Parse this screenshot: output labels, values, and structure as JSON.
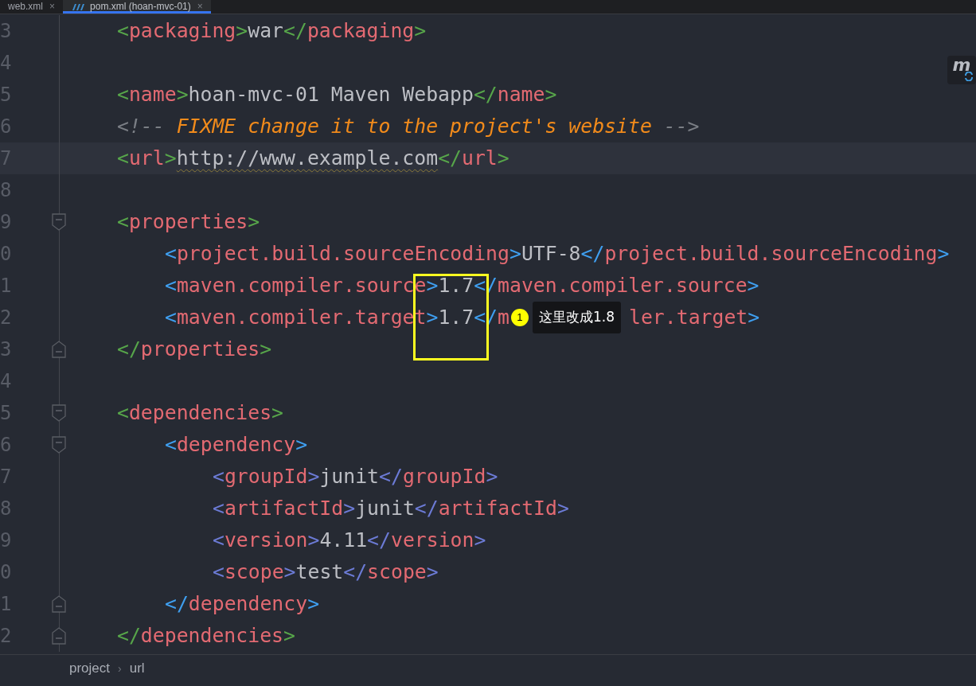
{
  "tabs": [
    {
      "label": "web.xml",
      "close": "×",
      "selected": false
    },
    {
      "label": "pom.xml (hoan-mvc-01)",
      "close": "×",
      "selected": true
    }
  ],
  "maven_button": {
    "glyph": "m"
  },
  "lines": [
    {
      "number": "3",
      "tokens": [
        {
          "kind": "bracket",
          "text": "<"
        },
        {
          "kind": "tag",
          "text": "packaging"
        },
        {
          "kind": "bracket",
          "text": ">"
        },
        {
          "kind": "text",
          "text": "war"
        },
        {
          "kind": "bracket",
          "text": "</"
        },
        {
          "kind": "tag",
          "text": "packaging"
        },
        {
          "kind": "bracket",
          "text": ">"
        }
      ]
    },
    {
      "number": "4"
    },
    {
      "number": "5",
      "tokens": [
        {
          "kind": "bracket",
          "text": "<"
        },
        {
          "kind": "tag",
          "text": "name"
        },
        {
          "kind": "bracket",
          "text": ">"
        },
        {
          "kind": "text",
          "text": "hoan-mvc-01 Maven Webapp"
        },
        {
          "kind": "bracket",
          "text": "</"
        },
        {
          "kind": "tag",
          "text": "name"
        },
        {
          "kind": "bracket",
          "text": ">"
        }
      ]
    },
    {
      "number": "6",
      "tokens": [
        {
          "kind": "comment",
          "text": "<!-- "
        },
        {
          "kind": "todo",
          "text": "FIXME change it to the project's website"
        },
        {
          "kind": "comment",
          "text": " -->"
        }
      ]
    },
    {
      "number": "7",
      "current": true,
      "tokens": [
        {
          "kind": "bracket",
          "text": "<"
        },
        {
          "kind": "tag",
          "text": "url"
        },
        {
          "kind": "bracket",
          "text": ">"
        },
        {
          "kind": "typo",
          "text": "http://www.example.com"
        },
        {
          "kind": "bracket",
          "text": "</"
        },
        {
          "kind": "tag",
          "text": "url"
        },
        {
          "kind": "bracket",
          "text": ">"
        }
      ]
    },
    {
      "number": "8"
    },
    {
      "number": "9",
      "fold": {
        "kind": "start"
      },
      "tokens": [
        {
          "kind": "bracket",
          "text": "<"
        },
        {
          "kind": "tag",
          "text": "properties"
        },
        {
          "kind": "bracket",
          "text": ">"
        }
      ]
    },
    {
      "number": "0",
      "tokens": [
        {
          "kind": "subbracket",
          "text": "<"
        },
        {
          "kind": "tag",
          "text": "project.build.sourceEncoding"
        },
        {
          "kind": "subbracket",
          "text": ">"
        },
        {
          "kind": "text",
          "text": "UTF-8"
        },
        {
          "kind": "subbracket",
          "text": "</"
        },
        {
          "kind": "tag",
          "text": "project.build.sourceEncoding"
        },
        {
          "kind": "subbracket",
          "text": ">"
        }
      ]
    },
    {
      "number": "1",
      "tokens": [
        {
          "kind": "subbracket",
          "text": "<"
        },
        {
          "kind": "tag",
          "text": "maven.compiler.source"
        },
        {
          "kind": "subbracket",
          "text": ">"
        },
        {
          "kind": "text",
          "text": "1.7"
        },
        {
          "kind": "subbracket",
          "text": "</"
        },
        {
          "kind": "tag",
          "text": "maven.compiler.source"
        },
        {
          "kind": "subbracket",
          "text": ">"
        }
      ]
    },
    {
      "number": "2",
      "tokens": [
        {
          "kind": "subbracket",
          "text": "<"
        },
        {
          "kind": "tag",
          "text": "maven.compiler.target"
        },
        {
          "kind": "subbracket",
          "text": ">"
        },
        {
          "kind": "text",
          "text": "1.7"
        },
        {
          "kind": "subbracket",
          "text": "</"
        },
        {
          "kind": "tag",
          "text": "m"
        },
        {
          "kind": "note",
          "marker": "1",
          "text": "这里改成1.8"
        },
        {
          "kind": "tag",
          "text": "ler.target"
        },
        {
          "kind": "subbracket",
          "text": ">"
        }
      ]
    },
    {
      "number": "3",
      "fold": {
        "kind": "end"
      },
      "tokens": [
        {
          "kind": "bracket",
          "text": "</"
        },
        {
          "kind": "tag",
          "text": "properties"
        },
        {
          "kind": "bracket",
          "text": ">"
        }
      ]
    },
    {
      "number": "4"
    },
    {
      "number": "5",
      "fold": {
        "kind": "start"
      },
      "tokens": [
        {
          "kind": "bracket",
          "text": "<"
        },
        {
          "kind": "tag",
          "text": "dependencies"
        },
        {
          "kind": "bracket",
          "text": ">"
        }
      ]
    },
    {
      "number": "6",
      "fold": {
        "kind": "start"
      },
      "tokens": [
        {
          "kind": "subbracket",
          "text": "<"
        },
        {
          "kind": "tag",
          "text": "dependency"
        },
        {
          "kind": "subbracket",
          "text": ">"
        }
      ]
    },
    {
      "number": "7",
      "tokens": [
        {
          "kind": "innerbracket",
          "text": "<"
        },
        {
          "kind": "tag",
          "text": "groupId"
        },
        {
          "kind": "innerbracket",
          "text": ">"
        },
        {
          "kind": "text",
          "text": "junit"
        },
        {
          "kind": "innerbracket",
          "text": "</"
        },
        {
          "kind": "tag",
          "text": "groupId"
        },
        {
          "kind": "innerbracket",
          "text": ">"
        }
      ]
    },
    {
      "number": "8",
      "tokens": [
        {
          "kind": "innerbracket",
          "text": "<"
        },
        {
          "kind": "tag",
          "text": "artifactId"
        },
        {
          "kind": "innerbracket",
          "text": ">"
        },
        {
          "kind": "text",
          "text": "junit"
        },
        {
          "kind": "innerbracket",
          "text": "</"
        },
        {
          "kind": "tag",
          "text": "artifactId"
        },
        {
          "kind": "innerbracket",
          "text": ">"
        }
      ]
    },
    {
      "number": "9",
      "tokens": [
        {
          "kind": "innerbracket",
          "text": "<"
        },
        {
          "kind": "tag",
          "text": "version"
        },
        {
          "kind": "innerbracket",
          "text": ">"
        },
        {
          "kind": "text",
          "text": "4.11"
        },
        {
          "kind": "innerbracket",
          "text": "</"
        },
        {
          "kind": "tag",
          "text": "version"
        },
        {
          "kind": "innerbracket",
          "text": ">"
        }
      ]
    },
    {
      "number": "0",
      "tokens": [
        {
          "kind": "innerbracket",
          "text": "<"
        },
        {
          "kind": "tag",
          "text": "scope"
        },
        {
          "kind": "innerbracket",
          "text": ">"
        },
        {
          "kind": "text",
          "text": "test"
        },
        {
          "kind": "innerbracket",
          "text": "</"
        },
        {
          "kind": "tag",
          "text": "scope"
        },
        {
          "kind": "innerbracket",
          "text": ">"
        }
      ]
    },
    {
      "number": "1",
      "fold": {
        "kind": "end"
      },
      "tokens": [
        {
          "kind": "subbracket",
          "text": "</"
        },
        {
          "kind": "tag",
          "text": "dependency"
        },
        {
          "kind": "subbracket",
          "text": ">"
        }
      ]
    },
    {
      "number": "2",
      "fold": {
        "kind": "end"
      },
      "tokens": [
        {
          "kind": "bracket",
          "text": "</"
        },
        {
          "kind": "tag",
          "text": "dependencies"
        },
        {
          "kind": "bracket",
          "text": ">"
        }
      ]
    }
  ],
  "breadcrumbs": [
    {
      "label": "project"
    },
    {
      "label": "url"
    }
  ],
  "breadcrumb_separator": "›"
}
